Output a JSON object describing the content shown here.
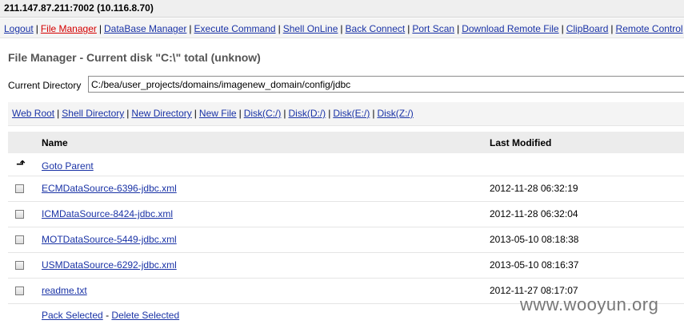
{
  "header": {
    "host": "211.147.87.211:7002 (10.116.8.70)"
  },
  "nav": [
    {
      "label": "Logout",
      "active": false
    },
    {
      "label": "File Manager",
      "active": true
    },
    {
      "label": "DataBase Manager",
      "active": false
    },
    {
      "label": "Execute Command",
      "active": false
    },
    {
      "label": "Shell OnLine",
      "active": false
    },
    {
      "label": "Back Connect",
      "active": false
    },
    {
      "label": "Port Scan",
      "active": false
    },
    {
      "label": "Download Remote File",
      "active": false
    },
    {
      "label": "ClipBoard",
      "active": false
    },
    {
      "label": "Remote Control",
      "active": false
    }
  ],
  "page": {
    "title": "File Manager - Current disk \"C:\\\" total (unknow)"
  },
  "directory": {
    "label": "Current Directory",
    "value": "C:/bea/user_projects/domains/imagenew_domain/config/jdbc"
  },
  "quick_links": [
    "Web Root",
    "Shell Directory",
    "New Directory",
    "New File",
    "Disk(C:/)",
    "Disk(D:/)",
    "Disk(E:/)",
    "Disk(Z:/)"
  ],
  "table": {
    "col_name": "Name",
    "col_modified": "Last Modified",
    "parent_label": "Goto Parent",
    "rows": [
      {
        "name": "ECMDataSource-6396-jdbc.xml",
        "modified": "2012-11-28 06:32:19"
      },
      {
        "name": "ICMDataSource-8424-jdbc.xml",
        "modified": "2012-11-28 06:32:04"
      },
      {
        "name": "MOTDataSource-5449-jdbc.xml",
        "modified": "2013-05-10 08:18:38"
      },
      {
        "name": "USMDataSource-6292-jdbc.xml",
        "modified": "2013-05-10 08:16:37"
      },
      {
        "name": "readme.txt",
        "modified": "2012-11-27 08:17:07"
      }
    ]
  },
  "actions": {
    "pack": "Pack Selected",
    "delete": "Delete Selected",
    "separator": "-"
  },
  "watermark": "www.wooyun.org",
  "colors": {
    "link": "#1a33a6",
    "active_link": "#d40000"
  }
}
